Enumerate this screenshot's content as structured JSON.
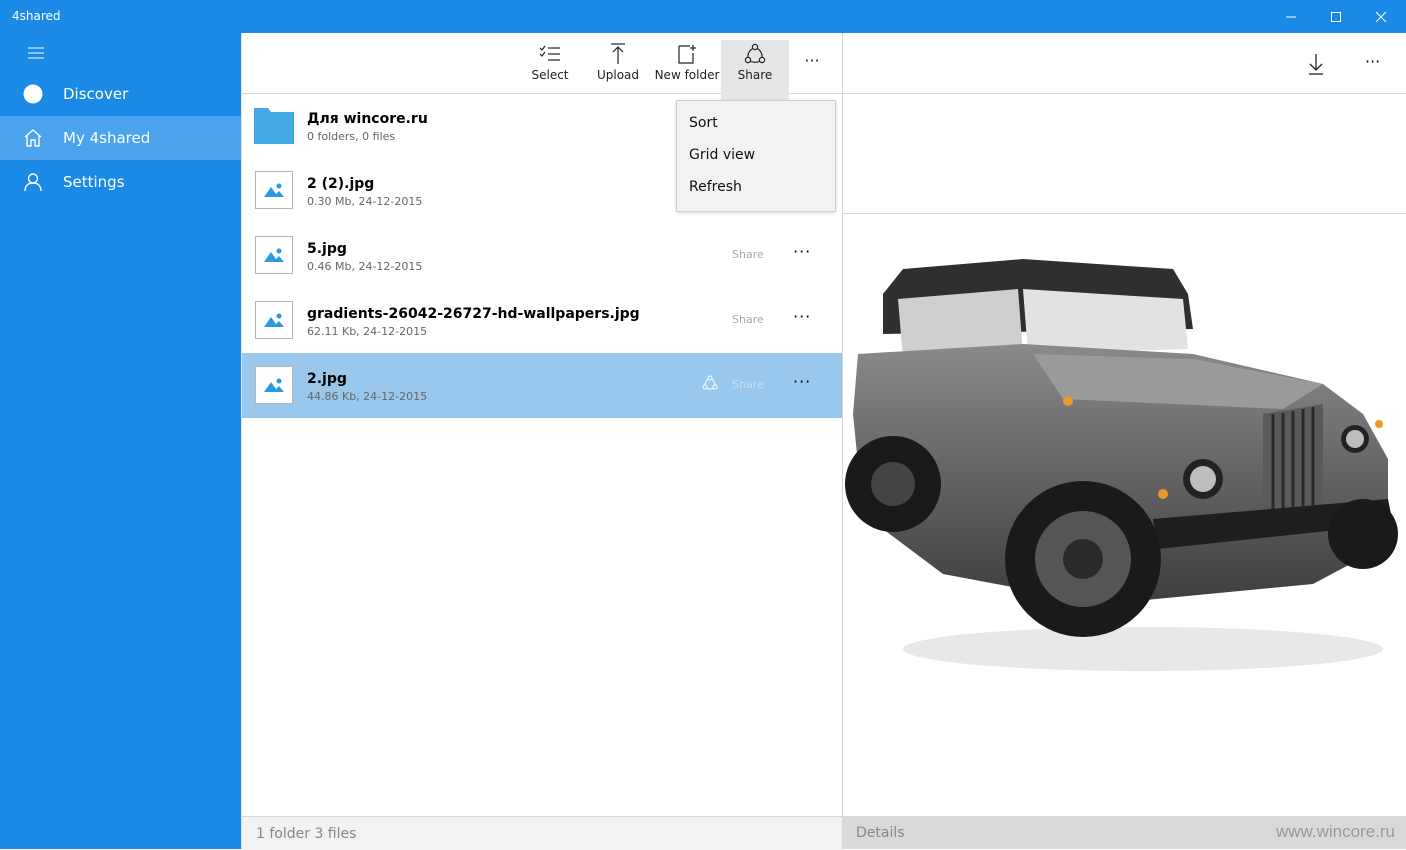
{
  "window": {
    "title": "4shared"
  },
  "sidebar": {
    "items": [
      {
        "label": "Discover",
        "icon": "circle-icon"
      },
      {
        "label": "My 4shared",
        "icon": "home-icon"
      },
      {
        "label": "Settings",
        "icon": "user-icon"
      }
    ]
  },
  "toolbar": {
    "select": "Select",
    "upload": "Upload",
    "new_folder": "New folder",
    "share": "Share",
    "more": "···"
  },
  "menu": {
    "items": [
      "Sort",
      "Grid view",
      "Refresh"
    ]
  },
  "files": [
    {
      "name": "Для wincore.ru",
      "meta": "0 folders, 0 files",
      "type": "folder"
    },
    {
      "name": "2 (2).jpg",
      "meta": "0.30 Mb, 24-12-2015",
      "type": "image"
    },
    {
      "name": "5.jpg",
      "meta": "0.46 Mb, 24-12-2015",
      "type": "image",
      "share": "Share"
    },
    {
      "name": "gradients-26042-26727-hd-wallpapers.jpg",
      "meta": "62.11 Kb, 24-12-2015",
      "type": "image",
      "share": "Share"
    },
    {
      "name": "2.jpg",
      "meta": "44.86 Kb, 24-12-2015",
      "type": "image",
      "share": "Share",
      "selected": true
    }
  ],
  "status": {
    "summary": "1 folder 3 files"
  },
  "details": {
    "label": "Details",
    "watermark": "www.wincore.ru"
  },
  "colors": {
    "accent": "#1a8ae6",
    "selected": "#99c8ec",
    "folder": "#42a9e6"
  }
}
